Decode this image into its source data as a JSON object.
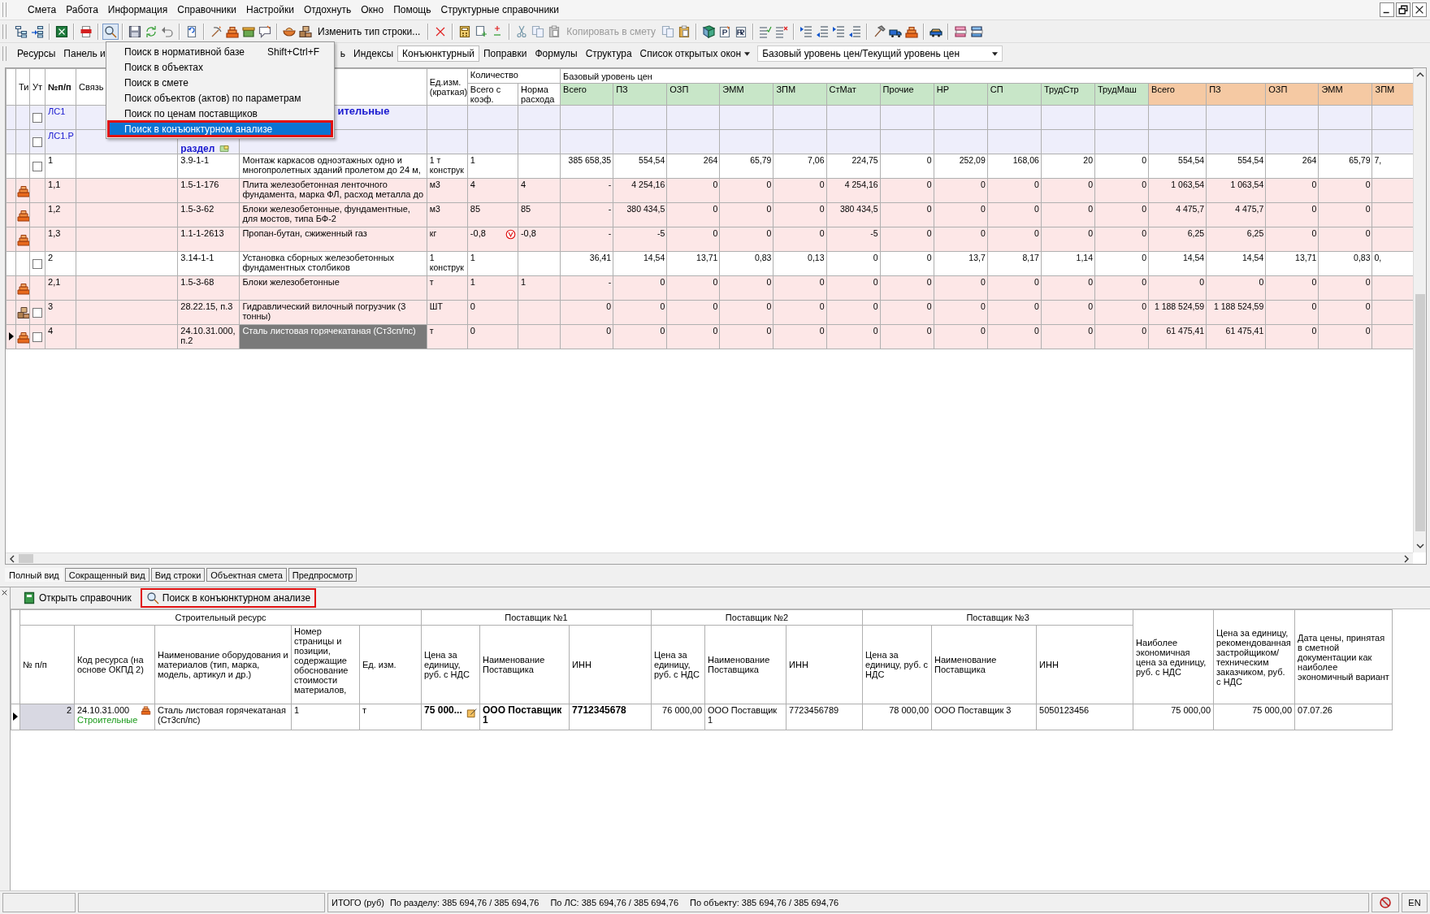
{
  "menu_bar": {
    "items": [
      "Смета",
      "Работа",
      "Информация",
      "Справочники",
      "Настройки",
      "Отдохнуть",
      "Окно",
      "Помощь",
      "Структурные справочники"
    ]
  },
  "toolbar": {
    "buttons": [
      {
        "label": "Изменить тип строки...",
        "disabled": false
      },
      {
        "label": "Копировать в смету",
        "disabled": true
      }
    ]
  },
  "view_bar": {
    "items": [
      {
        "label": "Ресурсы",
        "selected": false
      },
      {
        "label": "Панель и",
        "selected": false
      },
      {
        "label": "ь",
        "selected": false
      },
      {
        "label": "Индексы",
        "selected": false
      },
      {
        "label": "Конъюнктурный",
        "selected": true
      },
      {
        "label": "Поправки",
        "selected": false
      },
      {
        "label": "Формулы",
        "selected": false
      },
      {
        "label": "Структура",
        "selected": false
      }
    ],
    "windows_menu": "Список открытых окон",
    "price_level": "Базовый уровень цен/Текущий уровень цен"
  },
  "search_menu": {
    "open": true,
    "items": [
      {
        "label": "Поиск в нормативной базе",
        "shortcut": "Shift+Ctrl+F",
        "selected": false,
        "annotated": false
      },
      {
        "label": "Поиск в объектах",
        "selected": false,
        "annotated": false
      },
      {
        "label": "Поиск в смете",
        "selected": false,
        "annotated": false
      },
      {
        "label": "Поиск объектов (актов) по параметрам",
        "selected": false,
        "annotated": false
      },
      {
        "label": "Поиск по ценам поставщиков",
        "selected": false,
        "annotated": false
      },
      {
        "label": "Поиск в конъюнктурном анализе",
        "selected": true,
        "annotated": true
      }
    ]
  },
  "estimate_grid": {
    "columns": {
      "type": "Ти",
      "locked": "Ут",
      "number": "№п/п",
      "link": "Связь",
      "unit": "Ед.изм. (краткая)",
      "quantity": "Количество",
      "qty_total": "Всего с коэф.",
      "qty_norm": "Норма расхода",
      "base_level": "Базовый уровень цен",
      "price_columns": [
        {
          "label": "Всего",
          "kind": "base"
        },
        {
          "label": "ПЗ",
          "kind": "base"
        },
        {
          "label": "ОЗП",
          "kind": "base"
        },
        {
          "label": "ЭММ",
          "kind": "base"
        },
        {
          "label": "ЗПМ",
          "kind": "base"
        },
        {
          "label": "СтМат",
          "kind": "base"
        },
        {
          "label": "Прочие",
          "kind": "base"
        },
        {
          "label": "НР",
          "kind": "base"
        },
        {
          "label": "СП",
          "kind": "base"
        },
        {
          "label": "ТрудСтр",
          "kind": "base"
        },
        {
          "label": "ТрудМаш",
          "kind": "base"
        },
        {
          "label": "Всего",
          "kind": "current"
        },
        {
          "label": "ПЗ",
          "kind": "current"
        },
        {
          "label": "ОЗП",
          "kind": "current"
        },
        {
          "label": "ЭММ",
          "kind": "current"
        },
        {
          "label": "ЗПМ",
          "kind": "current"
        }
      ]
    },
    "rows": [
      {
        "kind": "estimate",
        "number": "ЛС1",
        "title": "ительные",
        "checked": false,
        "current": false
      },
      {
        "kind": "section",
        "number": "ЛС1.Р",
        "title": "раздел",
        "checked": false,
        "current": false
      },
      {
        "kind": "position",
        "number": "1",
        "code": "3.9-1-1",
        "name": "Монтаж каркасов одноэтажных одно и многопролетных зданий пролетом до 24 м,",
        "unit": "1 т конструк",
        "qty_total": "1",
        "flagged": false,
        "name_selected": false,
        "checked": false,
        "current": false,
        "prices": [
          "385 658,35",
          "554,54",
          "264",
          "65,79",
          "7,06",
          "224,75",
          "0",
          "252,09",
          "168,06",
          "20",
          "0",
          "554,54",
          "554,54",
          "264",
          "65,79",
          "7,"
        ]
      },
      {
        "kind": "resource",
        "number": "1,1",
        "code": "1.5-1-176",
        "name": "Плита железобетонная ленточного фундамента, марка ФЛ, расход металла до",
        "unit": "м3",
        "qty_total": "4",
        "qty_norm": "4",
        "flagged": false,
        "name_selected": false,
        "current": false,
        "prices": [
          "-",
          "4 254,16",
          "0",
          "0",
          "0",
          "4 254,16",
          "0",
          "0",
          "0",
          "0",
          "0",
          "1 063,54",
          "1 063,54",
          "0",
          "0"
        ]
      },
      {
        "kind": "resource",
        "number": "1,2",
        "code": "1.5-3-62",
        "name": "Блоки железобетонные, фундаментные, для мостов, типа БФ-2",
        "unit": "м3",
        "qty_total": "85",
        "qty_norm": "85",
        "flagged": false,
        "name_selected": false,
        "current": false,
        "prices": [
          "-",
          "380 434,5",
          "0",
          "0",
          "0",
          "380 434,5",
          "0",
          "0",
          "0",
          "0",
          "0",
          "4 475,7",
          "4 475,7",
          "0",
          "0"
        ]
      },
      {
        "kind": "resource",
        "number": "1,3",
        "code": "1.1-1-2613",
        "name": "Пропан-бутан, сжиженный газ",
        "unit": "кг",
        "qty_total": "-0,8",
        "qty_norm": "-0,8",
        "flagged": true,
        "name_selected": false,
        "current": false,
        "prices": [
          "-",
          "-5",
          "0",
          "0",
          "0",
          "-5",
          "0",
          "0",
          "0",
          "0",
          "0",
          "6,25",
          "6,25",
          "0",
          "0"
        ]
      },
      {
        "kind": "position",
        "number": "2",
        "code": "3.14-1-1",
        "name": "Установка сборных железобетонных фундаментных столбиков",
        "unit": "1 конструк",
        "qty_total": "1",
        "flagged": false,
        "name_selected": false,
        "checked": false,
        "current": false,
        "prices": [
          "36,41",
          "14,54",
          "13,71",
          "0,83",
          "0,13",
          "0",
          "0",
          "13,7",
          "8,17",
          "1,14",
          "0",
          "14,54",
          "14,54",
          "13,71",
          "0,83",
          "0,"
        ]
      },
      {
        "kind": "resource",
        "number": "2,1",
        "code": "1.5-3-68",
        "name": "Блоки железобетонные",
        "unit": "т",
        "qty_total": "1",
        "qty_norm": "1",
        "flagged": false,
        "name_selected": false,
        "current": false,
        "prices": [
          "-",
          "0",
          "0",
          "0",
          "0",
          "0",
          "0",
          "0",
          "0",
          "0",
          "0",
          "0",
          "0",
          "0",
          "0"
        ]
      },
      {
        "kind": "equipment",
        "number": "3",
        "code": "28.22.15, п.3",
        "name": "Гидравлический вилочный погрузчик (3 тонны)",
        "unit": "ШТ",
        "qty_total": "0",
        "flagged": false,
        "name_selected": false,
        "checked": false,
        "current": false,
        "prices": [
          "0",
          "0",
          "0",
          "0",
          "0",
          "0",
          "0",
          "0",
          "0",
          "0",
          "0",
          "1 188 524,59",
          "1 188 524,59",
          "0",
          "0"
        ]
      },
      {
        "kind": "material",
        "number": "4",
        "code": "24.10.31.000, п.2",
        "name": "Сталь листовая горячекатаная (Ст3сп/пс)",
        "unit": "т",
        "qty_total": "0",
        "flagged": false,
        "name_selected": true,
        "checked": false,
        "current": true,
        "prices": [
          "0",
          "0",
          "0",
          "0",
          "0",
          "0",
          "0",
          "0",
          "0",
          "0",
          "0",
          "61 475,41",
          "61 475,41",
          "0",
          "0"
        ]
      }
    ]
  },
  "view_tabs": [
    {
      "label": "Полный вид",
      "selected": true
    },
    {
      "label": "Сокращенный вид",
      "selected": false
    },
    {
      "label": "Вид строки",
      "selected": false
    },
    {
      "label": "Объектная смета",
      "selected": false
    },
    {
      "label": "Предпросмотр",
      "selected": false
    }
  ],
  "analysis_panel": {
    "toolbar": [
      {
        "label": "Открыть справочник",
        "annotated": false
      },
      {
        "label": "Поиск в конъюнктурном анализе",
        "annotated": true
      }
    ],
    "grid": {
      "groups": {
        "resource": "Строительный ресурс",
        "suppliers": [
          "Поставщик №1",
          "Поставщик №2",
          "Поставщик №3"
        ]
      },
      "columns": {
        "number": "№ п/п",
        "code": "Код ресурса (на основе ОКПД 2)",
        "name": "Наименование оборудования и материалов (тип, марка, модель, артикул и др.)",
        "page": "Номер страницы и позиции, содержащие обоснование стоимости материалов,",
        "unit": "Ед. изм.",
        "supplier_columns": [
          {
            "price": "Цена за единицу, руб. с НДС",
            "name": "Наименование Поставщика",
            "inn": "ИНН"
          },
          {
            "price": "Цена за единицу, руб. с НДС",
            "name": "Наименование Поставщика",
            "inn": "ИНН"
          },
          {
            "price": "Цена за единицу, руб. с НДС",
            "name": "Наименование Поставщика",
            "inn": "ИНН"
          }
        ],
        "best_price": "Наиболее экономичная цена за единицу, руб. с НДС",
        "recommended_price": "Цена за единицу, рекомендованная застройщиком/ техническим заказчиком, руб. с НДС",
        "price_date": "Дата цены, принятая в сметной документации как наиболее экономичный вариант"
      },
      "rows": [
        {
          "number": "2",
          "code": "24.10.31.000",
          "category": "Строительные",
          "name": "Сталь листовая горячекатаная (Ст3сп/пс)",
          "page": "1",
          "unit": "т",
          "current": true,
          "suppliers": [
            {
              "price": "75 000...",
              "name": "ООО Поставщик 1",
              "inn": "7712345678",
              "best": true
            },
            {
              "price": "76 000,00",
              "name": "ООО Поставщик 1",
              "inn": "7723456789",
              "best": false
            },
            {
              "price": "78 000,00",
              "name": "ООО Поставщик 3",
              "inn": "5050123456",
              "best": false
            }
          ],
          "best_price": "75 000,00",
          "recommended_price": "75 000,00",
          "price_date": "07.07.26"
        }
      ]
    }
  },
  "status_bar": {
    "total_label": "ИТОГО (руб)",
    "section": "По разделу: 385 694,76 / 385 694,76",
    "estimate": "По ЛС: 385 694,76 / 385 694,76",
    "object": "По объекту: 385 694,76 / 385 694,76",
    "language": "EN"
  }
}
